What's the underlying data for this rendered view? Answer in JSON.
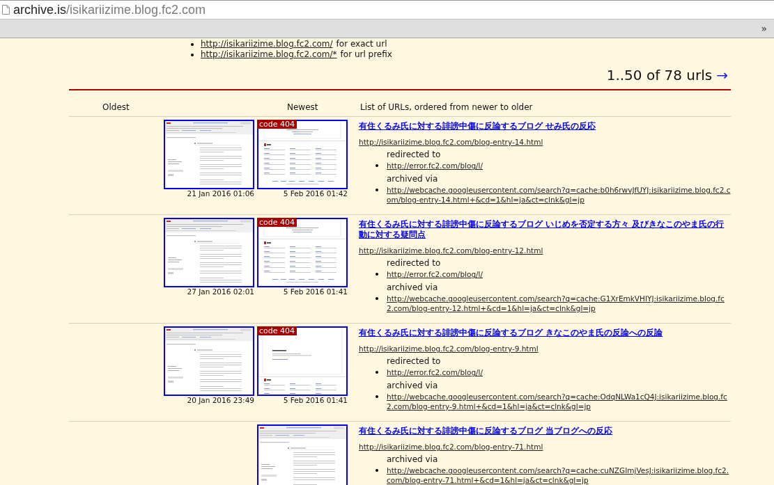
{
  "browser": {
    "address_host": "archive.is",
    "address_path": "/isikariizime.blog.fc2.com",
    "toolbar_overflow": "»"
  },
  "lookup_hints": [
    {
      "url": "http://isikariizime.blog.fc2.com/",
      "note": "for exact url"
    },
    {
      "url": "http://isikariizime.blog.fc2.com/*",
      "note": "for url prefix"
    }
  ],
  "pagination": {
    "range": "1..50 of 78 urls",
    "next": "→"
  },
  "table": {
    "columns": [
      "Oldest",
      "Newest",
      "List of URLs, ordered from newer to older"
    ],
    "rows": [
      {
        "oldest": {
          "date": "21 Jan 2016 01:06",
          "kind": "blog"
        },
        "newest": {
          "date": "5 Feb 2016 01:42",
          "kind": "error",
          "badge": "code 404"
        },
        "title": "有住くるみ氏に対する誹謗中傷に反論するブログ せみ氏の反応",
        "url": "http://isikariizime.blog.fc2.com/blog-entry-14.html",
        "details": [
          {
            "label": "redirected to",
            "link": "http://error.fc2.com/blog/l/"
          },
          {
            "label": "archived via",
            "link": "http://webcache.googleusercontent.com/search?q=cache:b0h6rwvJfUYJ:isikariizime.blog.fc2.com/blog-entry-14.html+&cd=1&hl=ja&ct=clnk&gl=jp"
          }
        ]
      },
      {
        "oldest": {
          "date": "27 Jan 2016 02:01",
          "kind": "blog"
        },
        "newest": {
          "date": "5 Feb 2016 01:41",
          "kind": "error",
          "badge": "code 404"
        },
        "title": "有住くるみ氏に対する誹謗中傷に反論するブログ いじめを否定する方々 及びきなこのやま氏の行動に対する疑問点",
        "url": "http://isikariizime.blog.fc2.com/blog-entry-12.html",
        "details": [
          {
            "label": "redirected to",
            "link": "http://error.fc2.com/blog/l/"
          },
          {
            "label": "archived via",
            "link": "http://webcache.googleusercontent.com/search?q=cache:G1XrEmkVHIYJ:isikariizime.blog.fc2.com/blog-entry-12.html+&cd=1&hl=ja&ct=clnk&gl=jp"
          }
        ]
      },
      {
        "oldest": {
          "date": "20 Jan 2016 23:49",
          "kind": "blog"
        },
        "newest": {
          "date": "5 Feb 2016 01:41",
          "kind": "not_found",
          "badge": "code 404"
        },
        "title": "有住くるみ氏に対する誹謗中傷に反論するブログ きなこのやま氏の反論への反論",
        "url": "http://isikariizime.blog.fc2.com/blog-entry-9.html",
        "details": [
          {
            "label": "redirected to",
            "link": "http://error.fc2.com/blog/l/"
          },
          {
            "label": "archived via",
            "link": "http://webcache.googleusercontent.com/search?q=cache:OdqNLWa1cQ4J:isikariizime.blog.fc2.com/blog-entry-9.html+&cd=1&hl=ja&ct=clnk&gl=jp"
          }
        ]
      },
      {
        "newest": {
          "kind": "blog"
        },
        "title": "有住くるみ氏に対する誹謗中傷に反論するブログ 当ブログへの反応",
        "url": "http://isikariizime.blog.fc2.com/blog-entry-71.html",
        "details": [
          {
            "label": "archived via",
            "link": "http://webcache.googleusercontent.com/search?q=cache:cuNZGImjVesJ:isikariizime.blog.fc2.com/blog-entry-71.html+&cd=1&hl=ja&ct=clnk&gl=jp"
          }
        ]
      }
    ]
  }
}
